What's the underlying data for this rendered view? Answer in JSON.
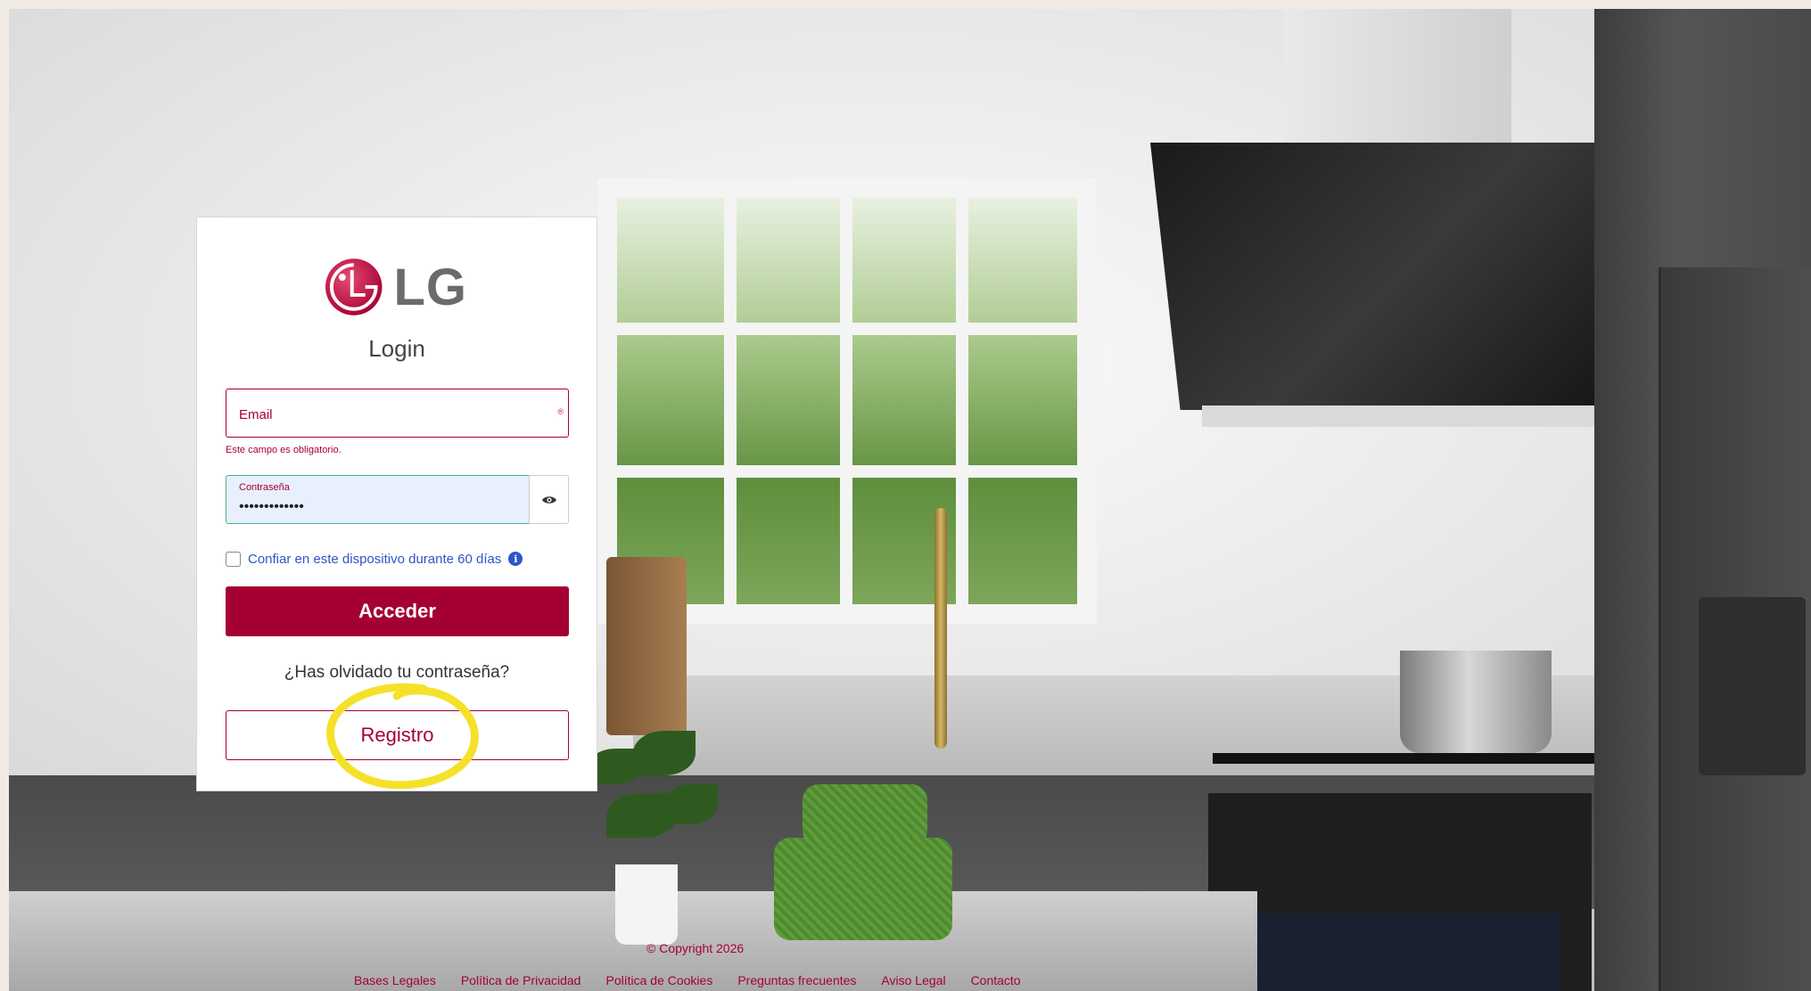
{
  "brand": {
    "logo_text": "LG",
    "primary_color": "#a50034",
    "link_color": "#2f55c8"
  },
  "login": {
    "title": "Login",
    "email": {
      "label": "Email",
      "required_mark": "®",
      "value": "",
      "error": "Este campo es obligatorio."
    },
    "password": {
      "label": "Contraseña",
      "masked_value": "•••••••••••••",
      "toggle_icon": "eye-icon"
    },
    "trust_device": {
      "label": "Confiar en este dispositivo durante 60 días",
      "checked": false,
      "info_icon": "info-icon",
      "info_glyph": "i"
    },
    "submit_label": "Acceder",
    "forgot_label": "¿Has olvidado tu contraseña?",
    "register_label": "Registro"
  },
  "annotation": {
    "highlight_color": "#f5e12a",
    "highlighted": "register-button"
  },
  "footer": {
    "copyright": "© Copyright 2026",
    "links": [
      "Bases Legales",
      "Política de Privacidad",
      "Política de Cookies",
      "Preguntas frecuentes",
      "Aviso Legal",
      "Contacto"
    ]
  }
}
